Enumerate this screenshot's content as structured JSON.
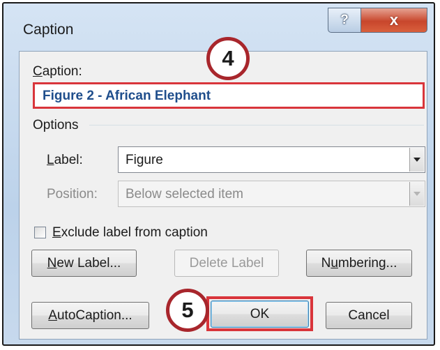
{
  "dialog": {
    "title": "Caption",
    "help_glyph": "?",
    "close_glyph": "x"
  },
  "caption": {
    "label_accesskey": "C",
    "label_rest": "aption:",
    "value": "Figure 2 - African Elephant"
  },
  "options": {
    "heading": "Options",
    "label": {
      "label_accesskey": "L",
      "label_rest": "abel:",
      "selected": "Figure"
    },
    "position": {
      "label": "Position:",
      "selected": "Below selected item",
      "enabled": false
    },
    "exclude": {
      "accesskey": "E",
      "rest": "xclude label from caption",
      "checked": false
    }
  },
  "buttons": {
    "new_label": {
      "accesskey": "N",
      "rest": "ew Label..."
    },
    "delete_label": {
      "label": "Delete Label",
      "enabled": false
    },
    "numbering": {
      "pre": "N",
      "accesskey": "u",
      "rest": "mbering..."
    },
    "autocaption": {
      "accesskey": "A",
      "rest": "utoCaption..."
    },
    "ok": "OK",
    "cancel": "Cancel"
  },
  "annotations": {
    "step4": "4",
    "step5": "5",
    "highlight_color": "#d9353b"
  }
}
